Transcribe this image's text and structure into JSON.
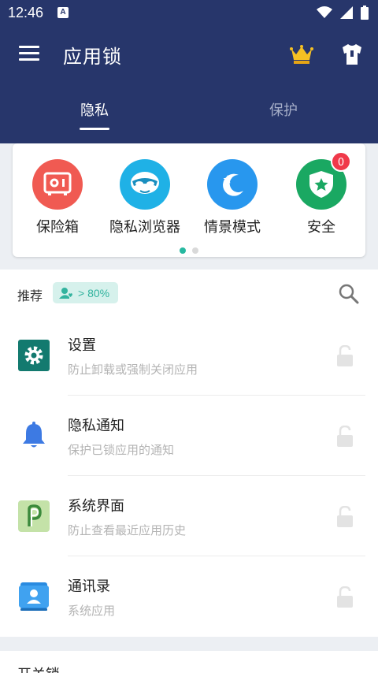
{
  "status_bar": {
    "time": "12:46",
    "notif_letter": "A"
  },
  "header": {
    "title": "应用锁",
    "tabs": [
      {
        "label": "隐私",
        "active": true
      },
      {
        "label": "保护",
        "active": false
      }
    ]
  },
  "features": [
    {
      "label": "保险箱",
      "icon": "safe-icon",
      "color": "#f05a52"
    },
    {
      "label": "隐私浏览器",
      "icon": "mask-icon",
      "color": "#1fb1e6"
    },
    {
      "label": "情景模式",
      "icon": "moon-star-icon",
      "color": "#2897ee"
    },
    {
      "label": "安全",
      "icon": "shield-star-icon",
      "color": "#1aa862",
      "badge": "0"
    }
  ],
  "carousel": {
    "pages": 2,
    "active": 0,
    "active_color": "#26b8a0"
  },
  "recommend": {
    "label": "推荐",
    "chip_text": "> 80%"
  },
  "apps": [
    {
      "name": "设置",
      "desc": "防止卸载或强制关闭应用",
      "icon": "settings-gear-icon"
    },
    {
      "name": "隐私通知",
      "desc": "保护已锁应用的通知",
      "icon": "bell-icon"
    },
    {
      "name": "系统界面",
      "desc": "防止查看最近应用历史",
      "icon": "android-p-icon"
    },
    {
      "name": "通讯录",
      "desc": "系统应用",
      "icon": "contacts-icon"
    }
  ],
  "bottom_section": {
    "label": "开关锁"
  }
}
